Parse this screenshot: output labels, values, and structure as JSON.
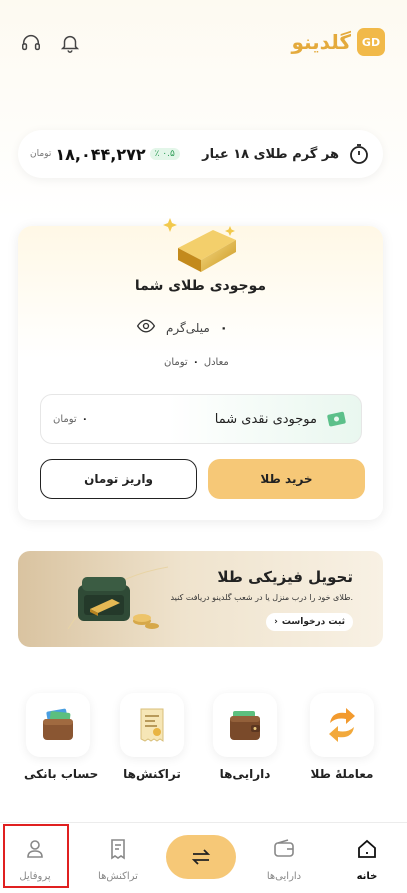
{
  "header": {
    "brand_name": "گلدینو",
    "brand_mark": "GD",
    "icons": [
      "notification-bell-icon",
      "headset-support-icon"
    ]
  },
  "price": {
    "title": "هر گرم طلای ۱۸ عیار",
    "value": "۱۸,۰۴۴,۲۷۲",
    "unit": "تومان",
    "change": "٪ ۰.۵",
    "change_color": "#2e9d57"
  },
  "gold_card": {
    "title": "موجودی طلای شما",
    "grams": "۰",
    "grams_unit": "میلی‌گرم",
    "equiv_label": "معادل",
    "equiv_value": "۰",
    "equiv_unit": "تومان",
    "cash_label": "موجودی نقدی شما",
    "cash_value": "۰",
    "cash_unit": "تومان",
    "buy_label": "خرید طلا",
    "deposit_label": "واریز تومان"
  },
  "banner": {
    "title": "تحویل فیزیکی طلا",
    "subtitle": "طلای خود را درب منزل یا در شعب گلدینو دریافت کنید.",
    "button_label": "ثبت درخواست"
  },
  "quick_actions": [
    {
      "label": "معاملهٔ طلا",
      "icon": "exchange-arrows-icon"
    },
    {
      "label": "دارایی‌ها",
      "icon": "wallet-icon"
    },
    {
      "label": "تراکنش‌ها",
      "icon": "receipt-icon"
    },
    {
      "label": "حساب بانکی",
      "icon": "bank-cards-icon"
    }
  ],
  "nav": {
    "home": "خانه",
    "assets": "دارایی‌ها",
    "transactions": "تراکنش‌ها",
    "profile": "پروفایل"
  },
  "colors": {
    "accent": "#f6c877",
    "brand": "#e4aa3c",
    "highlight": "#e02020"
  }
}
